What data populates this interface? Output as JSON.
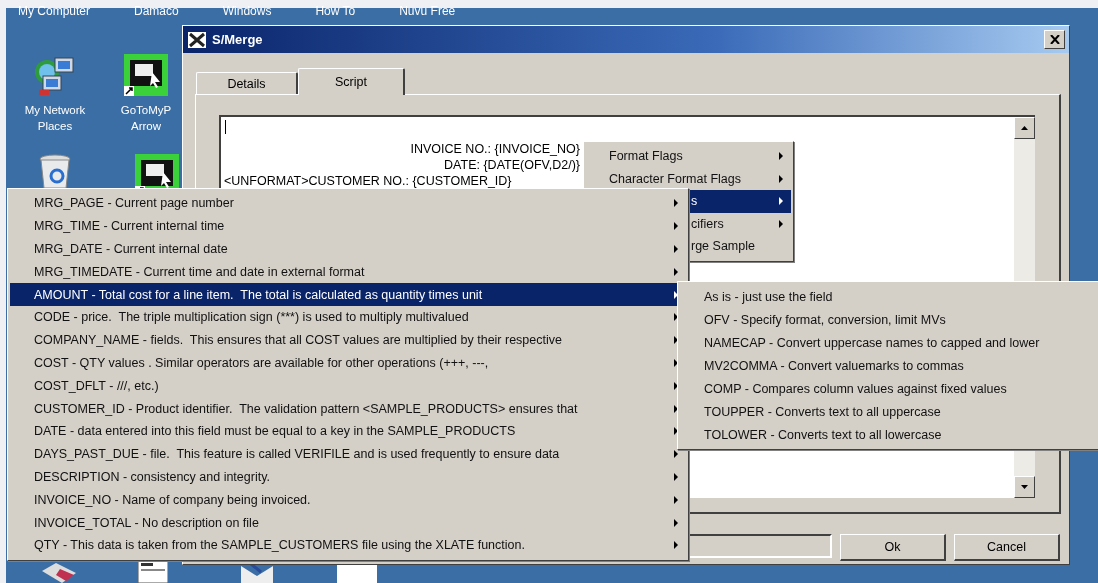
{
  "desktop": {
    "top_labels": [
      "My Computer",
      "Damaco",
      "Windows",
      "How To",
      "Nuvu Free"
    ],
    "icons": [
      {
        "lines": [
          "My Network",
          "Places"
        ]
      },
      {
        "lines": [
          "GoToMyP",
          "Arrow"
        ]
      }
    ]
  },
  "window": {
    "title": "S/Merge",
    "tabs": [
      {
        "label": "Details",
        "selected": false
      },
      {
        "label": "Script",
        "selected": true
      }
    ],
    "script_lines": [
      {
        "text": "INVOICE NO.: {INVOICE_NO}",
        "kind": "right"
      },
      {
        "text": "DATE: {DATE(OFV,D2/)}",
        "kind": "right"
      },
      {
        "text": "<UNFORMAT>CUSTOMER NO.: {CUSTOMER_ID}",
        "kind": "left"
      }
    ],
    "buttons": [
      "Ok",
      "Cancel"
    ]
  },
  "context_menu": {
    "items": [
      {
        "label": "Format Flags",
        "kind": "full",
        "selected": false
      },
      {
        "label": "Character Format Flags",
        "kind": "full",
        "selected": false
      },
      {
        "label": "s",
        "kind": "partial",
        "selected": true
      },
      {
        "label": "cifiers",
        "kind": "partial",
        "selected": false
      },
      {
        "label": "rge Sample",
        "kind": "partial",
        "selected": false,
        "submenu": false
      }
    ]
  },
  "fields_menu": {
    "items": [
      {
        "label": "MRG_PAGE - Current page number",
        "selected": false
      },
      {
        "label": "MRG_TIME - Current internal time",
        "selected": false
      },
      {
        "label": "MRG_DATE - Current internal date",
        "selected": false
      },
      {
        "label": "MRG_TIMEDATE - Current time and date in external format",
        "selected": false
      },
      {
        "label": "AMOUNT - Total cost for a line item.  The total is calculated as quantity times unit",
        "selected": true
      },
      {
        "label": "CODE - price.  The triple multiplication sign (***) is used to multiply multivalued",
        "selected": false
      },
      {
        "label": "COMPANY_NAME - fields.  This ensures that all COST values are multiplied by their respective",
        "selected": false
      },
      {
        "label": "COST - QTY values . Similar operators are available for other operations (+++, ---,",
        "selected": false
      },
      {
        "label": "COST_DFLT - ///, etc.)",
        "selected": false
      },
      {
        "label": "CUSTOMER_ID - Product identifier.  The validation pattern <SAMPLE_PRODUCTS> ensures that",
        "selected": false
      },
      {
        "label": "DATE - data entered into this field must be equal to a key in the SAMPLE_PRODUCTS",
        "selected": false
      },
      {
        "label": "DAYS_PAST_DUE - file.  This feature is called VERIFILE and is used frequently to ensure data",
        "selected": false
      },
      {
        "label": "DESCRIPTION - consistency and integrity.",
        "selected": false
      },
      {
        "label": "INVOICE_NO - Name of company being invoiced.",
        "selected": false
      },
      {
        "label": "INVOICE_TOTAL - No description on file",
        "selected": false
      },
      {
        "label": "QTY - This data is taken from the SAMPLE_CUSTOMERS file using the XLATE function.",
        "selected": false
      }
    ]
  },
  "format_submenu": {
    "items": [
      {
        "label": "As is - just use the field",
        "selected": false
      },
      {
        "label": "OFV - Specify format, conversion, limit MVs",
        "selected": false
      },
      {
        "label": "NAMECAP - Convert uppercase names to capped and lower",
        "selected": false
      },
      {
        "label": "MV2COMMA - Convert valuemarks to commas",
        "selected": false
      },
      {
        "label": "COMP - Compares column values against fixed values",
        "selected": false
      },
      {
        "label": "TOUPPER - Converts text to all uppercase",
        "selected": false
      },
      {
        "label": "TOLOWER - Converts text to all lowercase",
        "selected": false
      }
    ]
  }
}
